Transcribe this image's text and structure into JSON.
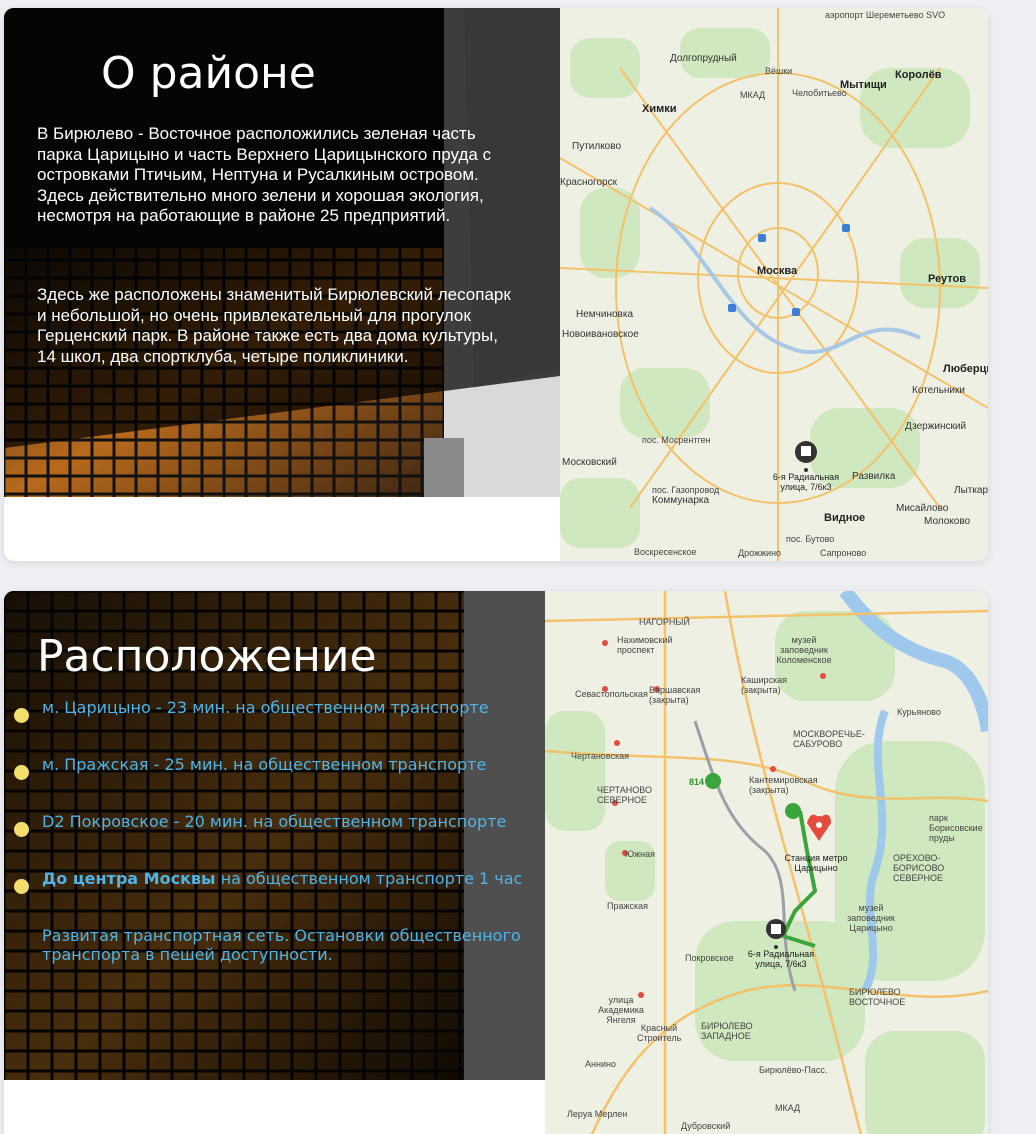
{
  "district": {
    "title": "О районе",
    "paragraph_1": "В Бирюлево - Восточное расположились зеленая часть парка Царицыно и часть Верхнего Царицынского пруда с островками Птичьим, Нептуна и Русалкиным островом. Здесь действительно много зелени и хорошая экология, несмотря на работающие в районе 25 предприятий.",
    "paragraph_2": "Здесь же расположены знаменитый Бирюлевский лесопарк и небольшой, но очень привлекательный для прогулок Герценский парк. В районе также есть два дома культуры, 14 школ, два спортклуба, четыре поликлиники.",
    "map": {
      "labels": {
        "airport": "аэропорт Шереметьево SVO",
        "dolgoprudny": "Долгопрудный",
        "vyoshki": "Вёшки",
        "mytishchi": "Мытищи",
        "korolyov": "Королёв",
        "chelobitievo": "Челобитьево",
        "khimki": "Химки",
        "mkad": "МКАД",
        "putilkovo": "Путилково",
        "krasnogorsk": "Красногорск",
        "moskva": "Москва",
        "reutov": "Реутов",
        "nemchinovka": "Немчиновка",
        "novoivanovskoe": "Новоивановское",
        "lyubertsy": "Люберцы",
        "kotelniki": "Котельники",
        "dzerzhinsky": "Дзержинский",
        "mosrentgen": "пос. Мосрентген",
        "moskovsky": "Московский",
        "gazoprovod": "пос. Газопровод",
        "kommunarka": "Коммунарка",
        "vidnoe": "Видное",
        "razvilka": "Развилка",
        "misaylovo": "Мисайлово",
        "molokovo": "Молоково",
        "lytkarino": "Лыткар",
        "butovo": "пос. Бутово",
        "drozhzhino": "Дрожжино",
        "sapronovo": "Сапроново",
        "voskresenskoe": "Воскресенское",
        "pin_address": "6-я Радиальная улица, 7/6к3"
      }
    }
  },
  "location": {
    "title": "Расположение",
    "routes": [
      {
        "text": "м. Царицыно - 23 мин. на общественном транспорте"
      },
      {
        "text": "м. Пражская - 25 мин. на общественном транспорте"
      },
      {
        "text": "D2 Покровское - 20 мин. на общественном транспорте"
      },
      {
        "bold": "До центра Москвы",
        "text": " на общественном транспорте 1 час"
      }
    ],
    "note": "Развитая транспортная сеть. Остановки общественного транспорта в пешей доступности.",
    "map": {
      "labels": {
        "nagorny": "НАГОРНЫЙ",
        "nakhimovsky": "Нахимовский проспект",
        "sevastopolskaya": "Севастопольская",
        "varshavskaya": "Варшавская (закрыта)",
        "kashirskaya": "Каширская (закрыта)",
        "kolomenskoe": "музей заповедник Коломенское",
        "kurjanovo": "Курьяново",
        "moskvorechye": "МОСКВОРЕЧЬЕ-САБУРОВО",
        "chertanovskaya": "Чертановская",
        "chertanovo": "ЧЕРТАНОВО СЕВЕРНОЕ",
        "kantemirovskaya": "Кантемировская (закрыта)",
        "bus_814": "814",
        "tsaritsyno_station": "Станция метро Царицыно",
        "borisovsky_park": "парк Борисовские пруды",
        "orekhovo": "ОРЕХОВО-БОРИСОВО СЕВЕРНОЕ",
        "tsaritsyno_museum": "музей заповедник Царицыно",
        "prazhskaya": "Пражская",
        "yuzhnaya": "Южная",
        "pokrovskoe": "Покровское",
        "pin_address": "6-я Радиальная улица, 7/6к3",
        "biryulyovo_vostochnoe": "БИРЮЛЕВО ВОСТОЧНОЕ",
        "biryulyovo_zapadnoe": "БИРЮЛЕВО ЗАПАДНОЕ",
        "yangelya": "улица Академика Янгеля",
        "krasny_stroitel": "Красный Строитель",
        "annino": "Аннино",
        "biryulyovo_pass": "Бирюлёво-Пасс.",
        "leruamerlen": "Леруа Мерлен",
        "dubrovsky": "Дубровский",
        "mkad": "МКАД"
      }
    }
  }
}
